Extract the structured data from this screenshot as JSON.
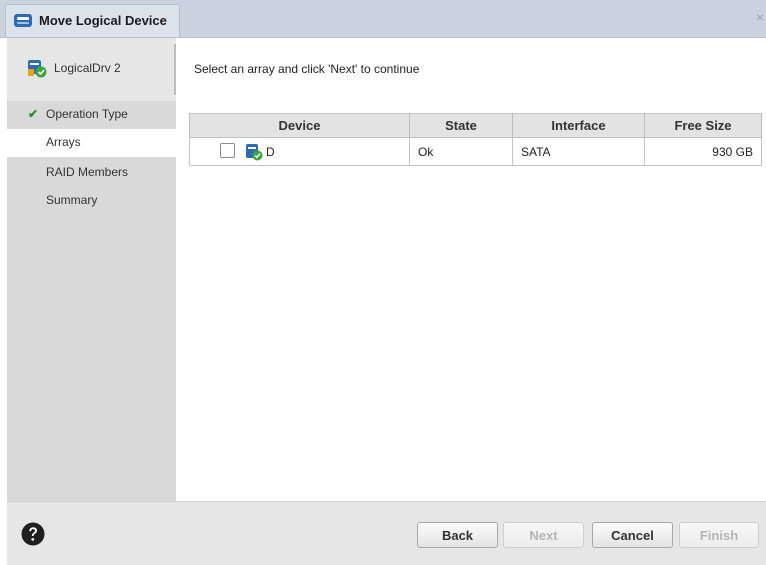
{
  "window": {
    "title": "Move Logical Device",
    "close_glyph": "×"
  },
  "sidebar": {
    "device_label": "LogicalDrv 2",
    "steps": [
      {
        "label": "Operation Type",
        "completed": true
      },
      {
        "label": "Arrays",
        "active": true
      },
      {
        "label": "RAID Members"
      },
      {
        "label": "Summary"
      }
    ],
    "check_glyph": "✔"
  },
  "main": {
    "instruction": "Select an array and click 'Next' to continue",
    "table": {
      "columns": [
        "Device",
        "State",
        "Interface",
        "Free Size"
      ],
      "rows": [
        {
          "device": "D",
          "state": "Ok",
          "interface": "SATA",
          "free_size": "930 GB",
          "checked": false
        }
      ]
    }
  },
  "footer": {
    "back": "Back",
    "next": "Next",
    "cancel": "Cancel",
    "finish": "Finish",
    "help_icon": "question-circle-icon"
  },
  "colors": {
    "titlebar": "#c9d2de",
    "sidebar": "#d9d9d9",
    "check": "#2e8b2e",
    "device_icon_blue": "#2b6bb3",
    "device_icon_green": "#3fa33f"
  }
}
